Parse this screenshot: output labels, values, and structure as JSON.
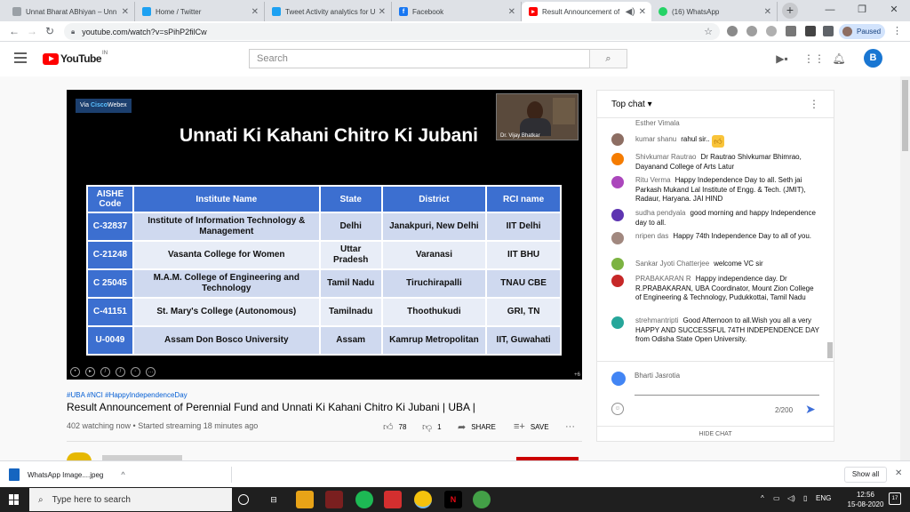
{
  "browser": {
    "tabs": [
      {
        "title": "Unnat Bharat ABhiyan – Unn",
        "fav_color": "#9aa0a6"
      },
      {
        "title": "Home / Twitter",
        "fav_color": "#1da1f2"
      },
      {
        "title": "Tweet Activity analytics for U",
        "fav_color": "#1da1f2"
      },
      {
        "title": "Facebook",
        "fav_color": "#1877f2"
      },
      {
        "title": "Result Announcement of",
        "fav_color": "#ff0000"
      },
      {
        "title": "(16) WhatsApp",
        "fav_color": "#25d366"
      }
    ],
    "url": "youtube.com/watch?v=sPihP2filCw",
    "profile_status": "Paused"
  },
  "youtube": {
    "logo_text": "YouTube",
    "region": "IN",
    "search_placeholder": "Search",
    "avatar_letter": "B"
  },
  "video": {
    "webex_prefix": "Via",
    "webex_brand": "Cisco",
    "webex_suffix": "Webex",
    "slide_title": "Unnati Ki Kahani Chitro Ki Jubani",
    "presenter": "Dr. Vijay Bhatkar",
    "player_badge": "+6",
    "table": {
      "headers": [
        "AISHE Code",
        "Institute Name",
        "State",
        "District",
        "RCI name"
      ],
      "rows": [
        [
          "C-32837",
          "Institute of Information Technology & Management",
          "Delhi",
          "Janakpuri, New Delhi",
          "IIT Delhi"
        ],
        [
          "C-21248",
          "Vasanta College for Women",
          "Uttar Pradesh",
          "Varanasi",
          "IIT BHU"
        ],
        [
          "C 25045",
          "M.A.M. College of Engineering and Technology",
          "Tamil Nadu",
          "Tiruchirapalli",
          "TNAU CBE"
        ],
        [
          "C-41151",
          "St. Mary's College (Autonomous)",
          "Tamilnadu",
          "Thoothukudi",
          "GRI, TN"
        ],
        [
          "U-0049",
          "Assam Don Bosco University",
          "Assam",
          "Kamrup Metropolitan",
          "IIT, Guwahati"
        ]
      ]
    },
    "hashtags": "#UBA #NCI #HappyIndependenceDay",
    "title": "Result Announcement of Perennial Fund and Unnati Ki Kahani Chitro Ki Jubani | UBA |",
    "meta": "402 watching now • Started streaming 18 minutes ago",
    "likes": "78",
    "dislikes": "1",
    "share_label": "SHARE",
    "save_label": "SAVE"
  },
  "chat": {
    "header": "Top chat",
    "messages": [
      {
        "author": "Esther Vimala",
        "text": "",
        "color": "#ffffff"
      },
      {
        "author": "kumar shanu",
        "text": "rahul sir..",
        "color": "#8d6e63",
        "emoji": true
      },
      {
        "author": "Shivkumar Rautrao",
        "text": "Dr Rautrao Shivkumar Bhimrao, Dayanand College of Arts Latur",
        "color": "#f57c00"
      },
      {
        "author": "Ritu Verma",
        "text": "Happy Independence Day to all. Seth jai Parkash Mukand Lal Institute of Engg. & Tech. (JMIT), Radaur, Haryana. JAI HIND",
        "color": "#ab47bc"
      },
      {
        "author": "sudha pendyala",
        "text": "good morning and happy Independence day to all.",
        "color": "#5e35b1"
      },
      {
        "author": "nripen das",
        "text": "Happy 74th Independence Day to all of you.",
        "color": "#a1887f"
      },
      {
        "author": "Sankar Jyoti Chatterjee",
        "text": "welcome VC sir",
        "color": "#7cb342"
      },
      {
        "author": "PRABAKARAN R",
        "text": "Happy independence day. Dr R.PRABAKARAN, UBA Coordinator, Mount Zion College of Engineering & Technology, Pudukkottai, Tamil Nadu",
        "color": "#c62828"
      },
      {
        "author": "strehmantripti",
        "text": "Good Afternoon to all.Wish you all a very HAPPY AND SUCCESSFUL 74TH INDEPENDENCE DAY from Odisha State Open University.",
        "color": "#26a69a"
      }
    ],
    "current_user": "Bharti Jasrotia",
    "char_count": "2/200",
    "hide_label": "HIDE CHAT"
  },
  "downloads": {
    "file": "WhatsApp Image....jpeg",
    "show_all": "Show all"
  },
  "taskbar": {
    "search_placeholder": "Type here to search",
    "lang": "ENG",
    "time": "12:56",
    "date": "15-08-2020",
    "notifications": "17"
  }
}
